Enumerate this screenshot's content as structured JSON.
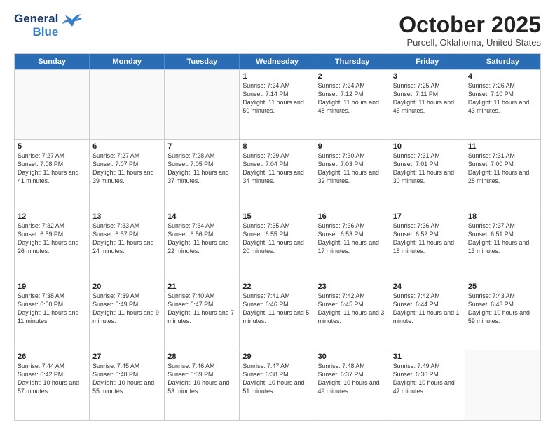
{
  "header": {
    "logo_general": "General",
    "logo_blue": "Blue",
    "month_title": "October 2025",
    "location": "Purcell, Oklahoma, United States"
  },
  "weekdays": [
    "Sunday",
    "Monday",
    "Tuesday",
    "Wednesday",
    "Thursday",
    "Friday",
    "Saturday"
  ],
  "rows": [
    [
      {
        "day": "",
        "sunrise": "",
        "sunset": "",
        "daylight": "",
        "empty": true
      },
      {
        "day": "",
        "sunrise": "",
        "sunset": "",
        "daylight": "",
        "empty": true
      },
      {
        "day": "",
        "sunrise": "",
        "sunset": "",
        "daylight": "",
        "empty": true
      },
      {
        "day": "1",
        "sunrise": "Sunrise: 7:24 AM",
        "sunset": "Sunset: 7:14 PM",
        "daylight": "Daylight: 11 hours and 50 minutes."
      },
      {
        "day": "2",
        "sunrise": "Sunrise: 7:24 AM",
        "sunset": "Sunset: 7:12 PM",
        "daylight": "Daylight: 11 hours and 48 minutes."
      },
      {
        "day": "3",
        "sunrise": "Sunrise: 7:25 AM",
        "sunset": "Sunset: 7:11 PM",
        "daylight": "Daylight: 11 hours and 45 minutes."
      },
      {
        "day": "4",
        "sunrise": "Sunrise: 7:26 AM",
        "sunset": "Sunset: 7:10 PM",
        "daylight": "Daylight: 11 hours and 43 minutes."
      }
    ],
    [
      {
        "day": "5",
        "sunrise": "Sunrise: 7:27 AM",
        "sunset": "Sunset: 7:08 PM",
        "daylight": "Daylight: 11 hours and 41 minutes."
      },
      {
        "day": "6",
        "sunrise": "Sunrise: 7:27 AM",
        "sunset": "Sunset: 7:07 PM",
        "daylight": "Daylight: 11 hours and 39 minutes."
      },
      {
        "day": "7",
        "sunrise": "Sunrise: 7:28 AM",
        "sunset": "Sunset: 7:05 PM",
        "daylight": "Daylight: 11 hours and 37 minutes."
      },
      {
        "day": "8",
        "sunrise": "Sunrise: 7:29 AM",
        "sunset": "Sunset: 7:04 PM",
        "daylight": "Daylight: 11 hours and 34 minutes."
      },
      {
        "day": "9",
        "sunrise": "Sunrise: 7:30 AM",
        "sunset": "Sunset: 7:03 PM",
        "daylight": "Daylight: 11 hours and 32 minutes."
      },
      {
        "day": "10",
        "sunrise": "Sunrise: 7:31 AM",
        "sunset": "Sunset: 7:01 PM",
        "daylight": "Daylight: 11 hours and 30 minutes."
      },
      {
        "day": "11",
        "sunrise": "Sunrise: 7:31 AM",
        "sunset": "Sunset: 7:00 PM",
        "daylight": "Daylight: 11 hours and 28 minutes."
      }
    ],
    [
      {
        "day": "12",
        "sunrise": "Sunrise: 7:32 AM",
        "sunset": "Sunset: 6:59 PM",
        "daylight": "Daylight: 11 hours and 26 minutes."
      },
      {
        "day": "13",
        "sunrise": "Sunrise: 7:33 AM",
        "sunset": "Sunset: 6:57 PM",
        "daylight": "Daylight: 11 hours and 24 minutes."
      },
      {
        "day": "14",
        "sunrise": "Sunrise: 7:34 AM",
        "sunset": "Sunset: 6:56 PM",
        "daylight": "Daylight: 11 hours and 22 minutes."
      },
      {
        "day": "15",
        "sunrise": "Sunrise: 7:35 AM",
        "sunset": "Sunset: 6:55 PM",
        "daylight": "Daylight: 11 hours and 20 minutes."
      },
      {
        "day": "16",
        "sunrise": "Sunrise: 7:36 AM",
        "sunset": "Sunset: 6:53 PM",
        "daylight": "Daylight: 11 hours and 17 minutes."
      },
      {
        "day": "17",
        "sunrise": "Sunrise: 7:36 AM",
        "sunset": "Sunset: 6:52 PM",
        "daylight": "Daylight: 11 hours and 15 minutes."
      },
      {
        "day": "18",
        "sunrise": "Sunrise: 7:37 AM",
        "sunset": "Sunset: 6:51 PM",
        "daylight": "Daylight: 11 hours and 13 minutes."
      }
    ],
    [
      {
        "day": "19",
        "sunrise": "Sunrise: 7:38 AM",
        "sunset": "Sunset: 6:50 PM",
        "daylight": "Daylight: 11 hours and 11 minutes."
      },
      {
        "day": "20",
        "sunrise": "Sunrise: 7:39 AM",
        "sunset": "Sunset: 6:49 PM",
        "daylight": "Daylight: 11 hours and 9 minutes."
      },
      {
        "day": "21",
        "sunrise": "Sunrise: 7:40 AM",
        "sunset": "Sunset: 6:47 PM",
        "daylight": "Daylight: 11 hours and 7 minutes."
      },
      {
        "day": "22",
        "sunrise": "Sunrise: 7:41 AM",
        "sunset": "Sunset: 6:46 PM",
        "daylight": "Daylight: 11 hours and 5 minutes."
      },
      {
        "day": "23",
        "sunrise": "Sunrise: 7:42 AM",
        "sunset": "Sunset: 6:45 PM",
        "daylight": "Daylight: 11 hours and 3 minutes."
      },
      {
        "day": "24",
        "sunrise": "Sunrise: 7:42 AM",
        "sunset": "Sunset: 6:44 PM",
        "daylight": "Daylight: 11 hours and 1 minute."
      },
      {
        "day": "25",
        "sunrise": "Sunrise: 7:43 AM",
        "sunset": "Sunset: 6:43 PM",
        "daylight": "Daylight: 10 hours and 59 minutes."
      }
    ],
    [
      {
        "day": "26",
        "sunrise": "Sunrise: 7:44 AM",
        "sunset": "Sunset: 6:42 PM",
        "daylight": "Daylight: 10 hours and 57 minutes."
      },
      {
        "day": "27",
        "sunrise": "Sunrise: 7:45 AM",
        "sunset": "Sunset: 6:40 PM",
        "daylight": "Daylight: 10 hours and 55 minutes."
      },
      {
        "day": "28",
        "sunrise": "Sunrise: 7:46 AM",
        "sunset": "Sunset: 6:39 PM",
        "daylight": "Daylight: 10 hours and 53 minutes."
      },
      {
        "day": "29",
        "sunrise": "Sunrise: 7:47 AM",
        "sunset": "Sunset: 6:38 PM",
        "daylight": "Daylight: 10 hours and 51 minutes."
      },
      {
        "day": "30",
        "sunrise": "Sunrise: 7:48 AM",
        "sunset": "Sunset: 6:37 PM",
        "daylight": "Daylight: 10 hours and 49 minutes."
      },
      {
        "day": "31",
        "sunrise": "Sunrise: 7:49 AM",
        "sunset": "Sunset: 6:36 PM",
        "daylight": "Daylight: 10 hours and 47 minutes."
      },
      {
        "day": "",
        "sunrise": "",
        "sunset": "",
        "daylight": "",
        "empty": true
      }
    ]
  ]
}
